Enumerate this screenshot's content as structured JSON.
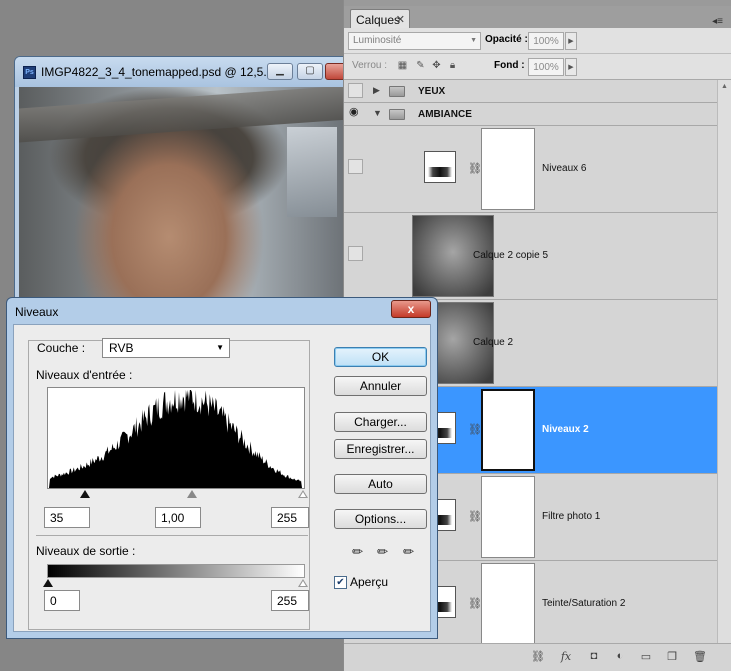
{
  "document": {
    "title": "IMGP4822_3_4_tonemapped.psd @ 12,5...",
    "app_icon_text": "Ps"
  },
  "layers_panel": {
    "tab_label": "Calques",
    "blend_mode": "Luminosité",
    "opacity_label": "Opacité :",
    "opacity_value": "100%",
    "lock_label": "Verrou :",
    "fill_label": "Fond :",
    "fill_value": "100%",
    "groups": [
      {
        "name": "YEUX",
        "visible": false,
        "expanded": false
      },
      {
        "name": "AMBIANCE",
        "visible": true,
        "expanded": true
      }
    ],
    "layers": [
      {
        "name": "Niveaux 6",
        "kind": "adjustment",
        "visible": false,
        "selected": false
      },
      {
        "name": "Calque 2 copie 5",
        "kind": "pixel",
        "visible": false,
        "selected": false
      },
      {
        "name": "Calque 2",
        "kind": "pixel",
        "visible": false,
        "selected": false
      },
      {
        "name": "Niveaux 2",
        "kind": "adjustment",
        "visible": false,
        "selected": true
      },
      {
        "name": "Filtre photo 1",
        "kind": "adjustment",
        "visible": false,
        "selected": false
      },
      {
        "name": "Teinte/Saturation 2",
        "kind": "adjustment",
        "visible": false,
        "selected": false
      }
    ],
    "selection_color": "#3b96ff"
  },
  "levels_dialog": {
    "title": "Niveaux",
    "close_symbol": "x",
    "channel_label": "Couche :",
    "channel_value": "RVB",
    "input_label": "Niveaux d'entrée :",
    "input_black": "35",
    "input_gamma": "1,00",
    "input_white": "255",
    "output_label": "Niveaux de sortie :",
    "output_black": "0",
    "output_white": "255",
    "buttons": {
      "ok": "OK",
      "cancel": "Annuler",
      "load": "Charger...",
      "save": "Enregistrer...",
      "auto": "Auto",
      "options": "Options..."
    },
    "preview_label": "Aperçu",
    "preview_checked": true
  }
}
